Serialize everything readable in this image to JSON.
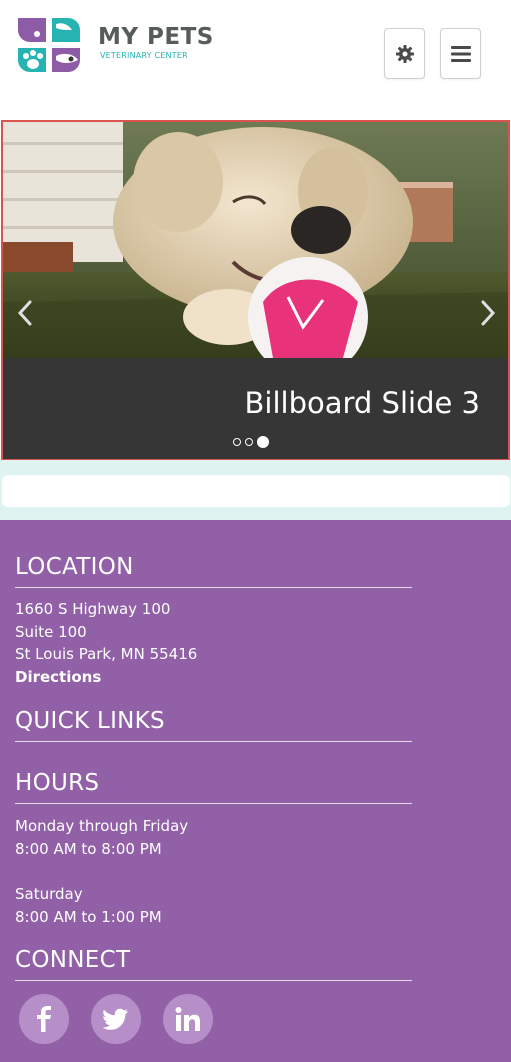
{
  "brand": {
    "name": "MY PETS",
    "tagline": "VETERINARY CENTER"
  },
  "header": {
    "settings_icon": "gear-icon",
    "menu_icon": "hamburger-menu-icon"
  },
  "billboard": {
    "slide_title": "Billboard Slide 3",
    "prev_icon": "chevron-left-icon",
    "next_icon": "chevron-right-icon",
    "slide_count": 3,
    "active_slide": 3
  },
  "footer": {
    "location": {
      "heading": "LOCATION",
      "address_line1": "1660 S Highway 100",
      "address_line2": "Suite 100",
      "address_line3": "St Louis Park, MN 55416",
      "directions_link": "Directions"
    },
    "quick_links": {
      "heading": "QUICK LINKS"
    },
    "hours": {
      "heading": "HOURS",
      "weekday_label": "Monday through Friday",
      "weekday_hours": "8:00 AM to 8:00 PM",
      "saturday_label": "Saturday",
      "saturday_hours": "8:00 AM to 1:00 PM"
    },
    "connect": {
      "heading": "CONNECT",
      "icons": [
        "facebook-icon",
        "twitter-icon",
        "linkedin-icon"
      ]
    }
  },
  "colors": {
    "footer_bg": "#9160a7",
    "accent_teal": "#27b3b1",
    "accent_purple": "#8e5ba6",
    "billboard_border": "#d9534f",
    "strip_bg": "#dff3f1"
  }
}
